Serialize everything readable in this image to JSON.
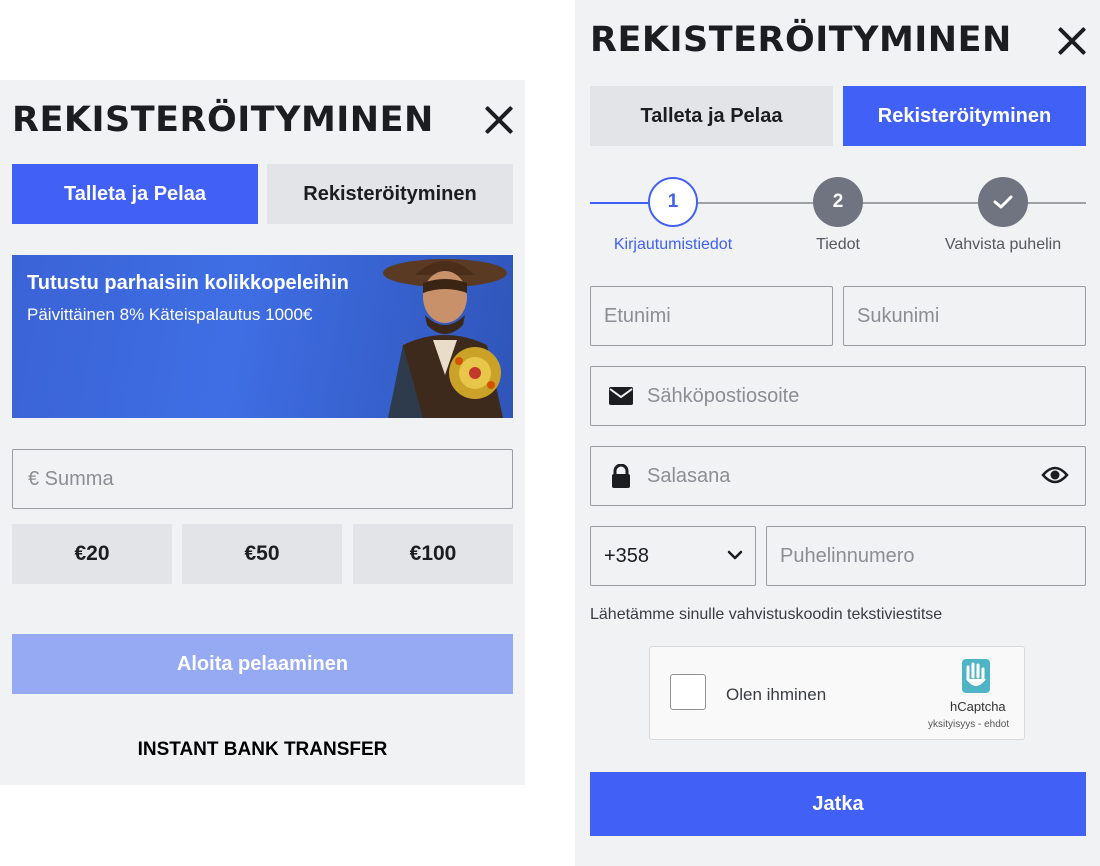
{
  "left": {
    "title": "REKISTERÖITYMINEN",
    "tabs": [
      {
        "label": "Talleta ja Pelaa",
        "active": true
      },
      {
        "label": "Rekisteröityminen",
        "active": false
      }
    ],
    "banner": {
      "title": "Tutustu parhaisiin kolikkopeleihin",
      "subtitle": "Päivittäinen 8% Käteispalautus 1000€"
    },
    "amount_input": {
      "placeholder": "€ Summa"
    },
    "amounts": [
      "€20",
      "€50",
      "€100"
    ],
    "start_button": "Aloita pelaaminen",
    "payment_method": "INSTANT BANK TRANSFER"
  },
  "right": {
    "title": "REKISTERÖITYMINEN",
    "tabs": [
      {
        "label": "Talleta ja Pelaa",
        "active": false
      },
      {
        "label": "Rekisteröityminen",
        "active": true
      }
    ],
    "steps": [
      {
        "number": "1",
        "label": "Kirjautumistiedot",
        "state": "current"
      },
      {
        "number": "2",
        "label": "Tiedot",
        "state": "pending"
      },
      {
        "number": "",
        "label": "Vahvista puhelin",
        "state": "check"
      }
    ],
    "first_name": {
      "placeholder": "Etunimi"
    },
    "last_name": {
      "placeholder": "Sukunimi"
    },
    "email": {
      "placeholder": "Sähköpostiosoite"
    },
    "password": {
      "placeholder": "Salasana"
    },
    "country_code": "+358",
    "phone": {
      "placeholder": "Puhelinnumero"
    },
    "sms_note": "Lähetämme sinulle vahvistuskoodin tekstiviestitse",
    "captcha": {
      "label": "Olen ihminen",
      "brand": "hCaptcha",
      "links": "yksityisyys - ehdot"
    },
    "continue_button": "Jatka"
  },
  "colors": {
    "accent": "#4160f5",
    "accent_disabled": "#96a9f3",
    "panel_bg": "#f0f2f4",
    "button_grey": "#e2e4e7"
  }
}
